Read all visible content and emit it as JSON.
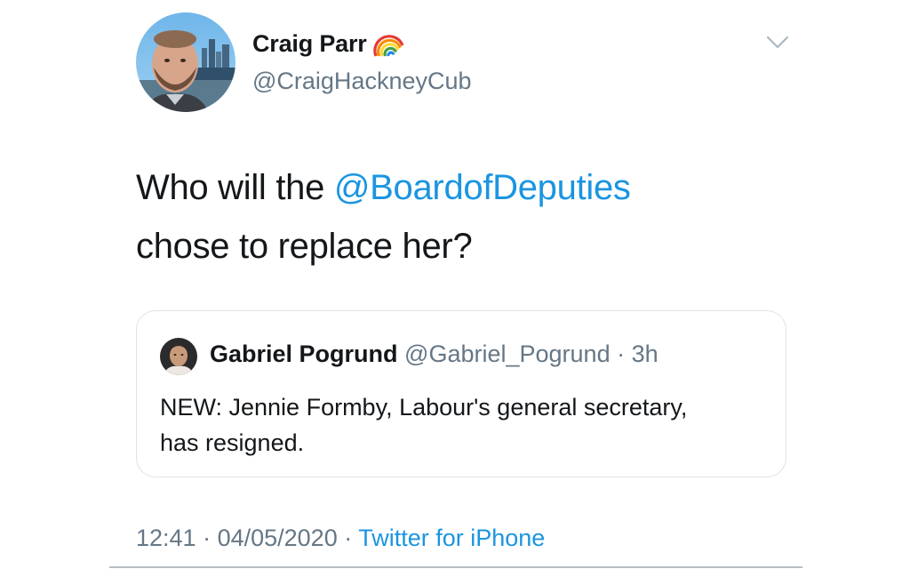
{
  "author": {
    "name": "Craig Parr",
    "handle": "@CraigHackneyCub",
    "avatar_icon": "profile-photo",
    "name_emoji_icon": "rainbow-icon"
  },
  "menu": {
    "icon": "chevron-down-icon"
  },
  "tweet": {
    "text_before": "Who will the ",
    "mention": "@BoardofDeputies",
    "text_after": " chose to replace her?"
  },
  "quoted_tweet": {
    "author_name": "Gabriel Pogrund",
    "author_handle": "@Gabriel_Pogrund",
    "separator": "·",
    "time": "3h",
    "text": "NEW: Jennie Formby, Labour's general secretary, has resigned."
  },
  "meta": {
    "time": "12:41",
    "separator1": " · ",
    "date": "04/05/2020",
    "separator2": " · ",
    "source": "Twitter for iPhone"
  },
  "colors": {
    "link": "#1b95e0",
    "secondary_text": "#657786",
    "primary_text": "#14171a",
    "border": "#dfe3e6"
  }
}
